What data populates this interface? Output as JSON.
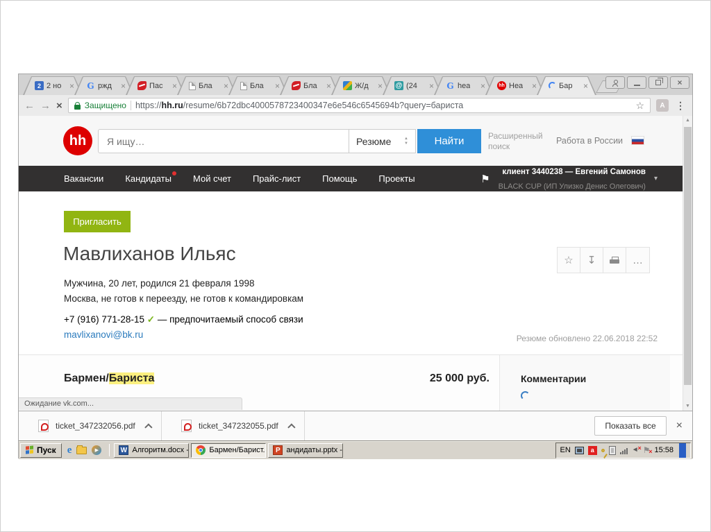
{
  "browser": {
    "tabs": [
      {
        "label": "2 но",
        "icon": "notes-2-icon"
      },
      {
        "label": "ржд",
        "icon": "google-icon"
      },
      {
        "label": "Пас",
        "icon": "rzd-icon"
      },
      {
        "label": "Бла",
        "icon": "blank-page-icon"
      },
      {
        "label": "Бла",
        "icon": "blank-page-icon"
      },
      {
        "label": "Бла",
        "icon": "rzd-icon"
      },
      {
        "label": "Ж/д",
        "icon": "rail-icon"
      },
      {
        "label": "(24",
        "icon": "mail-at-icon"
      },
      {
        "label": "hea",
        "icon": "google-icon"
      },
      {
        "label": "Hea",
        "icon": "hh-icon"
      },
      {
        "label": "Бар",
        "icon": "loading-spinner-icon"
      }
    ],
    "address_bar": {
      "security_label": "Защищено",
      "url_scheme": "https://",
      "url_domain": "hh.ru",
      "url_path": "/resume/6b72dbc4000578723400347e6e546c6545694b?query=бариста"
    }
  },
  "icons": {
    "close": "×",
    "back": "←",
    "forward": "→",
    "stop": "×",
    "star": "☆",
    "more_v": "⋮",
    "more_h": "…",
    "download": "↧",
    "check": "✓",
    "caret_down": "▾",
    "flag": "⚑",
    "select_up": "▲",
    "select_down": "▼",
    "scroll_up": "▲",
    "scroll_down": "▼",
    "play": "▶",
    "speaker": "◄",
    "tab2": "2",
    "google_g": "G",
    "at": "@",
    "hh_small": "hh",
    "adobe_a": "A",
    "hh_logo": "hh",
    "ie_e": "e",
    "word_w": "W",
    "ppt_p": "P",
    "avira_a": "a",
    "mute_x": "×",
    "flag_x": "×"
  },
  "hh_header": {
    "search_placeholder": "Я ищу…",
    "search_type": "Резюме",
    "find_button": "Найти",
    "advanced_search": "Расширенный поиск",
    "region_link": "Работа в России"
  },
  "nav": {
    "items": [
      {
        "label": "Вакансии"
      },
      {
        "label": "Кандидаты"
      },
      {
        "label": "Мой счет"
      },
      {
        "label": "Прайс-лист"
      },
      {
        "label": "Помощь"
      },
      {
        "label": "Проекты"
      }
    ],
    "client_line1": "клиент 3440238 — Евгений Самонов",
    "client_line2": "BLACK CUP (ИП Улизко Денис Олегович)"
  },
  "resume": {
    "invite_button": "Пригласить",
    "name": "Мавлиханов Ильяс",
    "demographics": "Мужчина, 20 лет, родился 21 февраля 1998",
    "location": "Москва, не готов к переезду, не готов к командировкам",
    "phone": "+7 (916) 771-28-15",
    "phone_note": "— предпочитаемый способ связи",
    "email": "mavlixanovi@bk.ru",
    "updated": "Резюме обновлено 22.06.2018 22:52",
    "position_prefix": "Бармен/",
    "position_highlight": "Бариста",
    "salary": "25 000 руб.",
    "comments_title": "Комментарии"
  },
  "status_bubble": "Ожидание vk.com...",
  "downloads": {
    "items": [
      {
        "name": "ticket_347232056.pdf"
      },
      {
        "name": "ticket_347232055.pdf"
      }
    ],
    "show_all": "Показать все"
  },
  "taskbar": {
    "start": "Пуск",
    "tasks": [
      {
        "label": "Алгоритм.docx - ..."
      },
      {
        "label": "Бармен/Барист..."
      },
      {
        "label": "андидаты.pptx - ..."
      }
    ],
    "tray": {
      "lang": "EN",
      "time": "15:58"
    }
  },
  "colors": {
    "hh_red": "#dd0000",
    "find_blue": "#2f8fd8",
    "invite_green": "#91b512",
    "secure_green": "#188038",
    "highlight_yellow": "#fcf07f",
    "nav_dark": "#323030",
    "taskbar_gray": "#d8d4cc"
  }
}
